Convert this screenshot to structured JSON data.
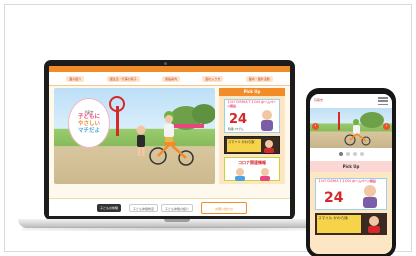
{
  "laptop_site": {
    "nav": [
      "園の紹介",
      "園生活・行事の様子",
      "施設案内",
      "園の入り方",
      "園内・園外活動"
    ],
    "logo": {
      "small": "鳥取市",
      "lines": [
        "子どもに",
        "やさしい",
        "マチだよ"
      ]
    },
    "pickup": {
      "title": "Pick Up",
      "banner1_head": "ＩＮＦＯＲＭＡＴＩＯＮ ホームページ開設",
      "banner1_num": "24",
      "banner1_sub": "時間いつでも",
      "banner2_text": "スマイル かわら版",
      "banner3_title": "コロナ関連情報"
    },
    "strip": {
      "btn1": "子どもの体験",
      "btn2": "子ども体験教室",
      "btn3": "子ども体験の紹介",
      "outline": "お問い合わせ"
    }
  },
  "phone_site": {
    "tag": "鳥取市",
    "pickup_title": "Pick Up",
    "banner1_head": "ＩＮＦＯＲＭＡＴＩＯＮ ホームページ開設",
    "banner1_num": "24",
    "banner2_text": "スマイル かわら版",
    "arrow_left": "‹",
    "arrow_right": "›"
  },
  "colors": {
    "accent_orange": "#f28c28",
    "accent_pink": "#e8467d",
    "pickup_bg": "#fde6c3"
  }
}
